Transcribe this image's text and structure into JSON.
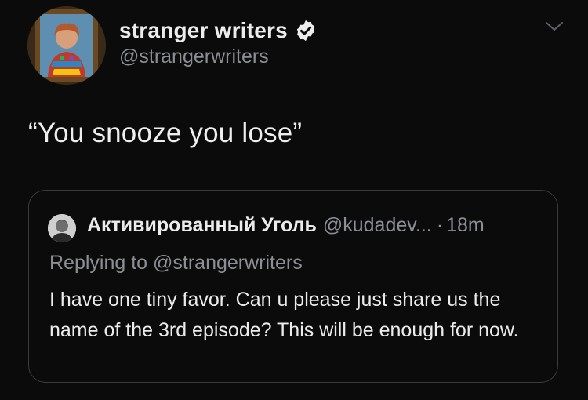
{
  "tweet": {
    "author_name": "stranger writers",
    "author_handle": "@strangerwriters",
    "text": "“You snooze you lose”",
    "verified_icon": "verified-badge-icon",
    "menu_icon": "chevron-down-icon"
  },
  "quoted": {
    "author_name": "Активированный Уголь",
    "author_handle": "@kudadev...",
    "separator": "·",
    "time": "18m",
    "replying_to": "Replying to @strangerwriters",
    "text": "I have one tiny favor. Can u please just share us the name of the 3rd episode? This will be enough for now."
  },
  "colors": {
    "background": "#0b0b0c",
    "primary_text": "#ececec",
    "secondary_text": "#8b8e93",
    "border": "#3a3b3e"
  }
}
